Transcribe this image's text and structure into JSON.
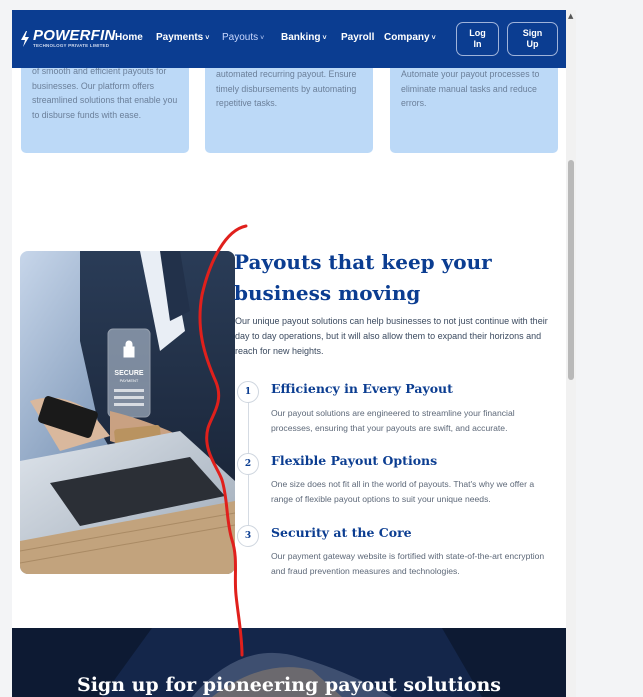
{
  "brand": {
    "name": "POWERFIN",
    "tagline": "TECHNOLOGY PRIVATE LIMITED"
  },
  "nav": {
    "items": [
      {
        "label": "Home"
      },
      {
        "label": "Payments",
        "caret": "˅"
      },
      {
        "label": "Payouts",
        "caret": "˅"
      },
      {
        "label": "Banking",
        "caret": "˅"
      },
      {
        "label": "Payroll"
      },
      {
        "label": "Company",
        "caret": "˅"
      }
    ],
    "login": "Log In",
    "signup": "Sign Up"
  },
  "cards": [
    {
      "text": "of smooth and efficient payouts for businesses. Our platform offers streamlined solutions that enable you to disburse funds with ease."
    },
    {
      "text": "automated recurring payout. Ensure timely disbursements by automating repetitive tasks."
    },
    {
      "text": "Automate your payout processes to eliminate manual tasks and reduce errors."
    }
  ],
  "payouts": {
    "title": "Payouts that keep your business moving",
    "intro": "Our unique payout solutions can help businesses to not just continue with their day to day operations, but it will also allow them to expand their horizons and reach for new heights.",
    "steps": [
      {
        "num": "1",
        "title": "Efficiency in Every Payout",
        "text": "Our payout solutions are engineered to streamline your financial processes, ensuring that your payouts are swift, and accurate."
      },
      {
        "num": "2",
        "title": "Flexible Payout Options",
        "text": "One size does not fit all in the world of payouts. That's why we offer a range of flexible payout options to suit your unique needs."
      },
      {
        "num": "3",
        "title": "Security at the Core",
        "text": "Our payment gateway website is fortified with state-of-the-art encryption and fraud prevention measures and technologies."
      }
    ],
    "image": {
      "badge": "SECURE",
      "badge_sub": "PAYMENT"
    }
  },
  "banner": {
    "title": "Sign up for pioneering payout solutions"
  },
  "scrollbar": {
    "up_arrow": "▲"
  },
  "colors": {
    "navy": "#0b3d91",
    "card_bg": "#bcd9f7",
    "annotation": "#e0201c"
  }
}
